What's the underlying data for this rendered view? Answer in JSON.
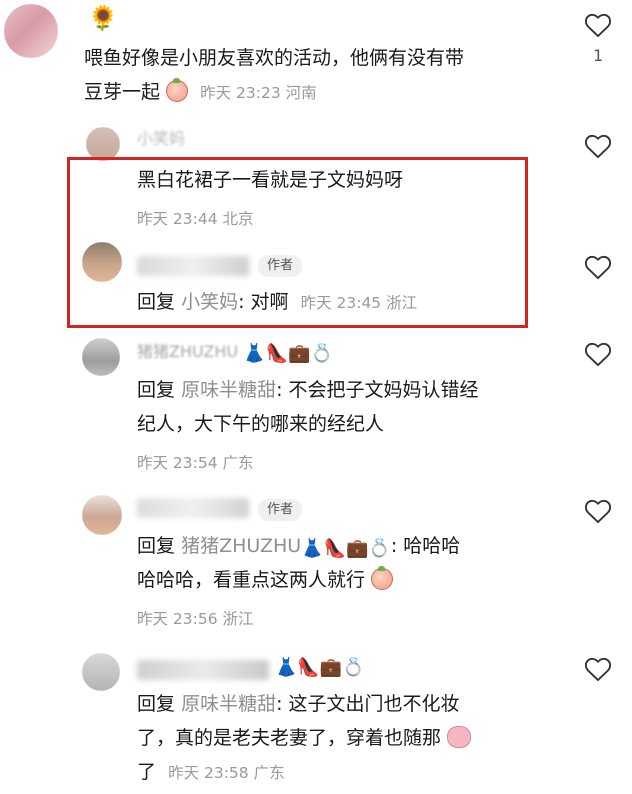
{
  "comments": [
    {
      "top_emoji": "🌻",
      "text_line1": "喂鱼好像是小朋友喜欢的活动，他俩有没有带",
      "text_line2": "豆芽一起",
      "meta": "昨天 23:23 河南",
      "likes": "1"
    }
  ],
  "replies": [
    {
      "name": "小笑妈",
      "text": "黑白花裙子一看就是子文妈妈呀",
      "meta": "昨天 23:44 北京"
    },
    {
      "badge": "作者",
      "reply_label": "回复",
      "reply_to": "小笑妈",
      "text": ": 对啊",
      "meta": "昨天 23:45 浙江"
    },
    {
      "name": "猪猪ZHUZHU",
      "name_emojis": "👗👠💼💍",
      "reply_label": "回复",
      "reply_to": "原味半糖甜",
      "text_line1": ": 不会把子文妈妈认错经",
      "text_line2": "纪人，大下午的哪来的经纪人",
      "meta": "昨天 23:54 广东"
    },
    {
      "badge": "作者",
      "reply_label": "回复",
      "reply_to": "猪猪ZHUZHU",
      "reply_to_emojis": "👗👠💼💍",
      "text_line1_tail": ": 哈哈哈",
      "text_line2": "哈哈哈，看重点这两人就行",
      "meta": "昨天 23:56 浙江"
    },
    {
      "name_emojis": "👗👠💼💍",
      "reply_label": "回复",
      "reply_to": "原味半糖甜",
      "text_line1": ": 这子文出门也不化妆",
      "text_line2": "了，真的是老夫老妻了，穿着也随那",
      "text_line3": "了",
      "meta": "昨天 23:58 广东"
    }
  ],
  "colors": {
    "highlight_border": "#d32323",
    "meta_gray": "#9a9a9a",
    "reply_name_gray": "#8f8f8f"
  },
  "icons": [
    "heart-outline-icon",
    "peach-sticker-icon",
    "pig-sticker-icon"
  ]
}
